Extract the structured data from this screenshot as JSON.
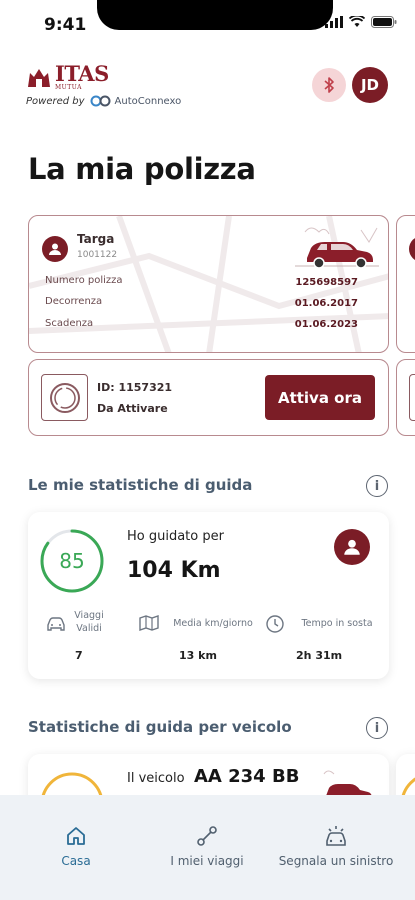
{
  "status_bar": {
    "time": "9:41"
  },
  "header": {
    "brand": "ITAS",
    "brand_sub": "MUTUA",
    "powered_by": "Powered by",
    "partner": "AutoConnexo",
    "avatar_initials": "JD"
  },
  "page_title": "La mia polizza",
  "policy_card": {
    "label": "Targa",
    "code": "1001122",
    "rows": [
      {
        "label": "Numero polizza",
        "value": "125698597"
      },
      {
        "label": "Decorrenza",
        "value": "01.06.2017"
      },
      {
        "label": "Scadenza",
        "value": "01.06.2023"
      }
    ]
  },
  "activate_card": {
    "id_text": "ID: 1157321",
    "status": "Da Attivare",
    "button": "Attiva ora"
  },
  "stats_section": {
    "title": "Le mie statistiche di guida",
    "score": "85",
    "score_fraction": 0.85,
    "drove_label": "Ho guidato per",
    "drove_value": "104 Km",
    "metrics": [
      {
        "label": "Viaggi Validi",
        "value": "7",
        "icon": "car-icon"
      },
      {
        "label": "Media km/giorno",
        "value": "13 km",
        "icon": "map-icon"
      },
      {
        "label": "Tempo in sosta",
        "value": "2h 31m",
        "icon": "clock-icon"
      }
    ]
  },
  "vehicle_section": {
    "title": "Statistiche di guida per veicolo",
    "label": "Il veicolo",
    "plate": "AA 234 BB"
  },
  "bottom_nav": [
    {
      "label": "Casa",
      "icon": "home-icon",
      "active": true
    },
    {
      "label": "I miei viaggi",
      "icon": "route-icon",
      "active": false
    },
    {
      "label": "Segnala un sinistro",
      "icon": "crash-icon",
      "active": false
    }
  ],
  "colors": {
    "brand": "#7b1d26",
    "score_green": "#3aa856",
    "section_title": "#4b5d70",
    "nav_active": "#2a6c95"
  }
}
